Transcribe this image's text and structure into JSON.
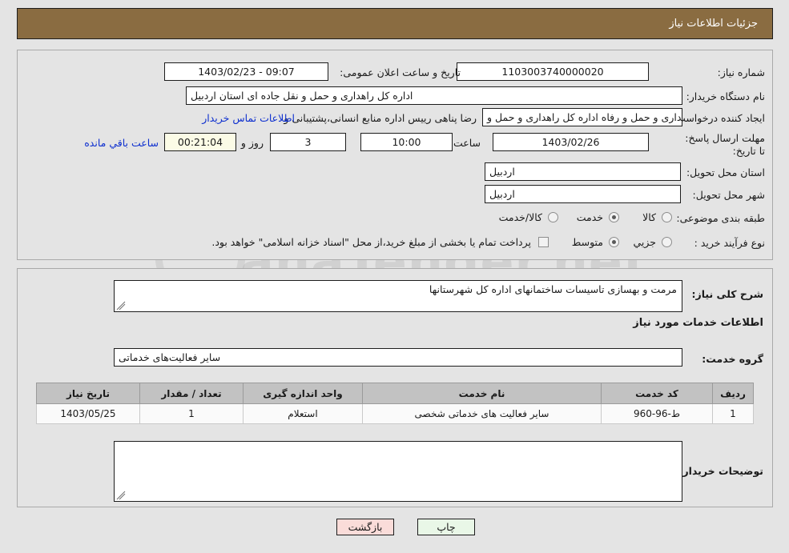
{
  "header": {
    "title": "جزئیات اطلاعات نیاز"
  },
  "top_form": {
    "need_number_label": "شماره نیاز:",
    "need_number_value": "1103003740000020",
    "public_announce_label": "تاریخ و ساعت اعلان عمومی:",
    "public_announce_value": "1403/02/23 - 09:07",
    "buyer_org_label": "نام دستگاه خریدار:",
    "buyer_org_value": "اداره کل راهداری و حمل و نقل جاده ای استان اردبیل",
    "creator_label": "ایجاد کننده درخواست:",
    "creator_value": "اداره کل راهداری و حمل و رفاه اداره کل راهداری و حمل و",
    "creator_value_tail": "رضا پناهی رییس اداره منابع انسانی،پشتیبانی و",
    "contact_link": "اطلاعات تماس خریدار",
    "deadline_label": "مهلت ارسال پاسخ: تا تاریخ:",
    "deadline_date": "1403/02/26",
    "hour_label": "ساعت",
    "hour_value": "10:00",
    "days_value": "3",
    "days_label": "روز و",
    "countdown_value": "00:21:04",
    "remaining_label": "ساعت باقي مانده",
    "province_label": "استان محل تحویل:",
    "province_value": "اردبیل",
    "city_label": "شهر محل تحویل:",
    "city_value": "اردبیل",
    "category_label": "طبقه بندی موضوعی:",
    "category_options": [
      {
        "label": "کالا",
        "selected": false
      },
      {
        "label": "خدمت",
        "selected": true
      },
      {
        "label": "کالا/خدمت",
        "selected": false
      }
    ],
    "process_label": "نوع فرآیند خرید :",
    "process_options": [
      {
        "label": "جزیي",
        "selected": false
      },
      {
        "label": "متوسط",
        "selected": true
      }
    ],
    "treasury_checkbox_label": "پرداخت تمام یا بخشی از مبلغ خرید،از محل \"اسناد خزانه اسلامی\" خواهد بود.",
    "treasury_checked": false
  },
  "mid_form": {
    "general_desc_label": "شرح کلی نیاز:",
    "general_desc_value": "مرمت و بهسازی تاسیسات ساختمانهای اداره کل شهرستانها",
    "services_info_title": "اطلاعات خدمات مورد نیاز",
    "service_group_label": "گروه خدمت:",
    "service_group_value": "سایر فعالیت‌های خدماتی",
    "buyer_notes_label": "توضیحات خریدار:",
    "buyer_notes_value": ""
  },
  "table": {
    "columns": [
      "ردیف",
      "کد خدمت",
      "نام خدمت",
      "واحد اندازه گیری",
      "تعداد / مقدار",
      "تاریخ نیاز"
    ],
    "rows": [
      {
        "row": "1",
        "code": "ط-96-960",
        "name": "سایر فعالیت های خدماتی شخصی",
        "unit": "استعلام",
        "qty": "1",
        "date": "1403/05/25"
      }
    ]
  },
  "footer": {
    "print_label": "چاپ",
    "back_label": "بازگشت"
  },
  "watermark": {
    "text": "anaTender.net"
  },
  "colors": {
    "header_bg": "#8a6c41",
    "page_bg": "#e4e4e4",
    "link": "#0d2fcf",
    "table_header_bg": "#c2c2c2",
    "print_btn_bg": "#e9f7e7",
    "back_btn_bg": "#fadcd9",
    "countdown_bg": "#fbfbe6"
  }
}
